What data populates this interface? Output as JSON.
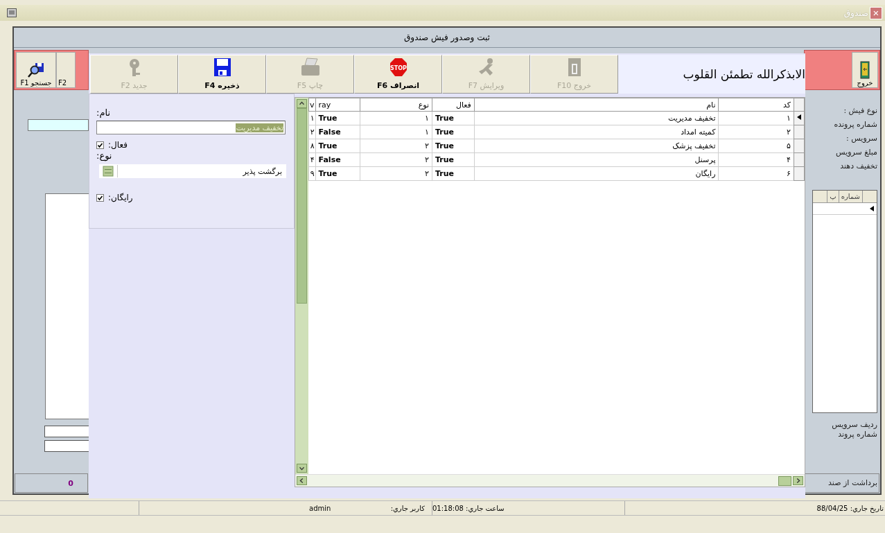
{
  "window": {
    "title": "صندوق",
    "close_glyph": "×"
  },
  "form": {
    "title": "ثبت وصدور فیش صندوق",
    "toolbar_left": [
      {
        "label": "F2"
      },
      {
        "label": "جستجو F1"
      }
    ],
    "toolbar_right": [
      {
        "label": "خروج"
      }
    ],
    "labels": [
      "نوع فیش :",
      "شماره پرونده",
      "سرویس :",
      "مبلغ سرویس",
      "تخفیف دهند"
    ],
    "mini_grid": {
      "columns": [
        "شماره",
        "پ"
      ]
    },
    "bottom_labels": [
      "ردیف سرویس",
      "شماره پروند"
    ],
    "footer": {
      "label": "برداشت از صند",
      "amount": "0"
    }
  },
  "dialog": {
    "motto": "الابذکرالله تطمئن القلوب",
    "toolbar": [
      {
        "label": "خروج F10",
        "disabled": true
      },
      {
        "label": "ویرایش F7",
        "disabled": true
      },
      {
        "label": "انصراف F6",
        "icon_text": "STOP",
        "disabled": false
      },
      {
        "label": "چاپ F5",
        "disabled": true
      },
      {
        "label": "ذخیره F4",
        "disabled": false
      },
      {
        "label": "جدید F2",
        "disabled": true
      }
    ],
    "fields": [
      {
        "kind": "text",
        "label": "نام:",
        "value": "تخفیف مدیریت",
        "text_selected": true
      },
      {
        "kind": "checkbox",
        "label": "فعال:",
        "checked": true
      },
      {
        "kind": "combo",
        "label": "نوع:",
        "value": "برگشت پذیر"
      },
      {
        "kind": "checkbox",
        "label": "رایگان:",
        "checked": true
      }
    ],
    "table": {
      "columns": [
        "کد",
        "نام",
        "فعال",
        "نوع",
        "ray",
        "v"
      ],
      "rows": [
        {
          "selected": true,
          "cells": [
            "۱",
            "تخفیف مدیریت",
            "True",
            "۱",
            "True",
            "۱"
          ]
        },
        {
          "selected": false,
          "cells": [
            "۲",
            "کمیته امداد",
            "True",
            "۱",
            "False",
            "۲"
          ]
        },
        {
          "selected": false,
          "cells": [
            "۵",
            "تخفیف پزشک",
            "True",
            "۲",
            "True",
            "۸"
          ]
        },
        {
          "selected": false,
          "cells": [
            "۴",
            "پرسنل",
            "True",
            "۲",
            "False",
            "۴"
          ]
        },
        {
          "selected": false,
          "cells": [
            "۶",
            "رایگان",
            "True",
            "۲",
            "True",
            "۹"
          ]
        }
      ]
    }
  },
  "status_bar": {
    "date": "تاریخ جاري: 88/04/25",
    "time": "ساعت جاري: 01:18:08",
    "user_label": "کاربر جاري:",
    "user": "admin"
  }
}
